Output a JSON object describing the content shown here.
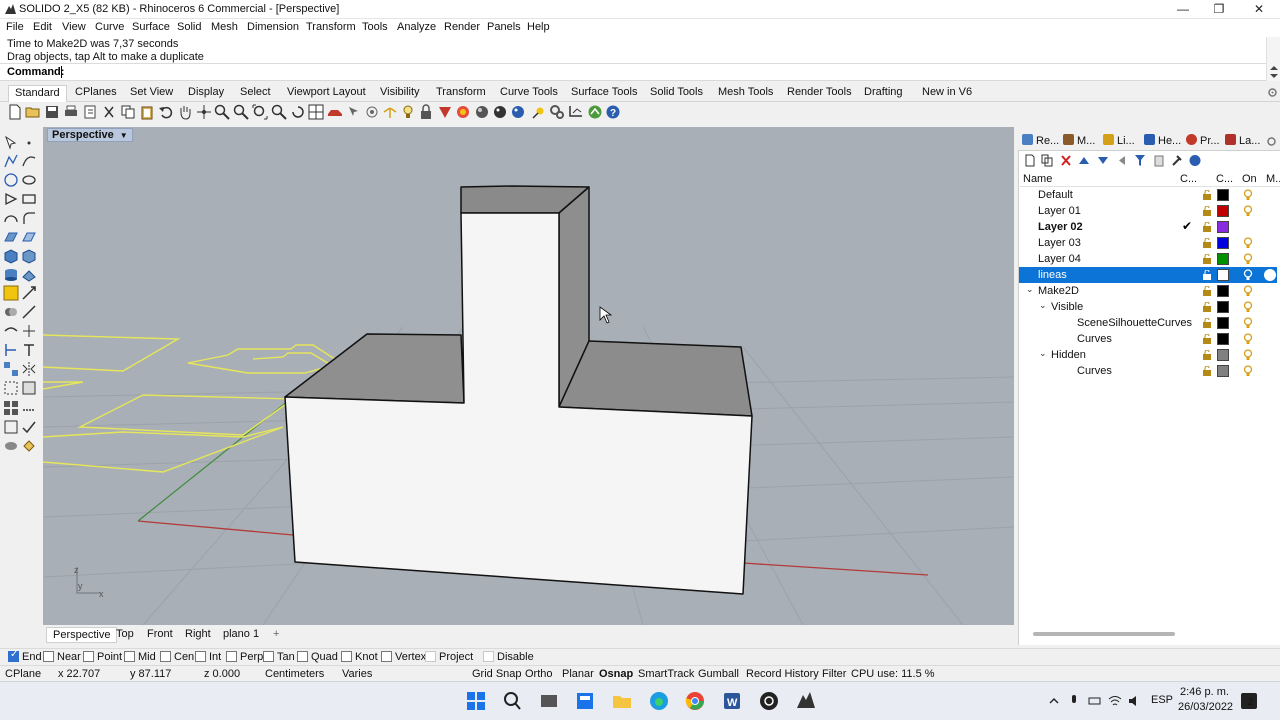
{
  "window": {
    "title": "SOLIDO 2_X5 (82 KB) - Rhinoceros 6 Commercial - [Perspective]",
    "controls": [
      "—",
      "❐",
      "✕"
    ]
  },
  "menu": [
    "File",
    "Edit",
    "View",
    "Curve",
    "Surface",
    "Solid",
    "Mesh",
    "Dimension",
    "Transform",
    "Tools",
    "Analyze",
    "Render",
    "Panels",
    "Help"
  ],
  "command": {
    "history": [
      "Time to Make2D was 7,37 seconds",
      "Drag objects, tap Alt to make a duplicate"
    ],
    "prompt_label": "Command:",
    "value": ""
  },
  "toolbar_tabs": {
    "active": "Standard",
    "items": [
      "Standard",
      "CPlanes",
      "Set View",
      "Display",
      "Select",
      "Viewport Layout",
      "Visibility",
      "Transform",
      "Curve Tools",
      "Surface Tools",
      "Solid Tools",
      "Mesh Tools",
      "Render Tools",
      "Drafting",
      "New in V6"
    ]
  },
  "viewport": {
    "name": "Perspective",
    "axis_labels": {
      "x": "x",
      "y": "y",
      "z": "z"
    }
  },
  "viewport_tabs": {
    "active": "Perspective",
    "items": [
      "Perspective",
      "Top",
      "Front",
      "Right",
      "plano 1"
    ],
    "add": "+"
  },
  "osnap": [
    {
      "label": "End",
      "checked": true
    },
    {
      "label": "Near",
      "checked": false
    },
    {
      "label": "Point",
      "checked": false
    },
    {
      "label": "Mid",
      "checked": false
    },
    {
      "label": "Cen",
      "checked": false
    },
    {
      "label": "Int",
      "checked": false
    },
    {
      "label": "Perp",
      "checked": false
    },
    {
      "label": "Tan",
      "checked": false
    },
    {
      "label": "Quad",
      "checked": false
    },
    {
      "label": "Knot",
      "checked": false
    },
    {
      "label": "Vertex",
      "checked": false
    },
    {
      "label": "Project",
      "checked": false
    },
    {
      "label": "Disable",
      "checked": false
    }
  ],
  "status": {
    "cplane": "CPlane",
    "x": "x 22.707",
    "y": "y 87.117",
    "z": "z 0.000",
    "units": "Centimeters",
    "layer": "Varies",
    "grid_snap": "Grid Snap",
    "ortho": "Ortho",
    "planar": "Planar",
    "osnap": "Osnap",
    "smarttrack": "SmartTrack",
    "gumball": "Gumball",
    "record_history": "Record History",
    "filter": "Filter",
    "cpu": "CPU use: 11.5 %"
  },
  "panel": {
    "tabs": [
      "Re...",
      "M...",
      "Li...",
      "He...",
      "Pr...",
      "La..."
    ],
    "tab_colors": [
      "#4a7fc1",
      "#8a5a2b",
      "#d4a017",
      "#2a5db0",
      "#c0392b",
      "#b0302a"
    ],
    "columns": {
      "name": "Name",
      "current": "C...",
      "color": "C...",
      "on": "On",
      "material": "M..."
    },
    "layers": [
      {
        "name": "Default",
        "indent": 0,
        "color": "#000000",
        "bold": false,
        "current": false,
        "selected": false,
        "expand": ""
      },
      {
        "name": "Layer 01",
        "indent": 0,
        "color": "#c00000",
        "bold": false,
        "current": false,
        "selected": false,
        "expand": ""
      },
      {
        "name": "Layer 02",
        "indent": 0,
        "color": "#8a2be2",
        "bold": true,
        "current": true,
        "selected": false,
        "expand": ""
      },
      {
        "name": "Layer 03",
        "indent": 0,
        "color": "#0000e0",
        "bold": false,
        "current": false,
        "selected": false,
        "expand": ""
      },
      {
        "name": "Layer 04",
        "indent": 0,
        "color": "#009000",
        "bold": false,
        "current": false,
        "selected": false,
        "expand": ""
      },
      {
        "name": "lineas",
        "indent": 0,
        "color": "#ffffff",
        "bold": false,
        "current": false,
        "selected": true,
        "expand": ""
      },
      {
        "name": "Make2D",
        "indent": 0,
        "color": "#000000",
        "bold": false,
        "current": false,
        "selected": false,
        "expand": "⌄"
      },
      {
        "name": "Visible",
        "indent": 1,
        "color": "#000000",
        "bold": false,
        "current": false,
        "selected": false,
        "expand": "⌄"
      },
      {
        "name": "SceneSilhouetteCurves",
        "indent": 2,
        "color": "#000000",
        "bold": false,
        "current": false,
        "selected": false,
        "expand": ""
      },
      {
        "name": "Curves",
        "indent": 2,
        "color": "#000000",
        "bold": false,
        "current": false,
        "selected": false,
        "expand": ""
      },
      {
        "name": "Hidden",
        "indent": 1,
        "color": "#808080",
        "bold": false,
        "current": false,
        "selected": false,
        "expand": "⌄"
      },
      {
        "name": "Curves",
        "indent": 2,
        "color": "#808080",
        "bold": false,
        "current": false,
        "selected": false,
        "expand": ""
      }
    ]
  },
  "taskbar": {
    "language": "ESP",
    "time": "2:46 p. m.",
    "date": "26/03/2022",
    "notifications": "2"
  }
}
